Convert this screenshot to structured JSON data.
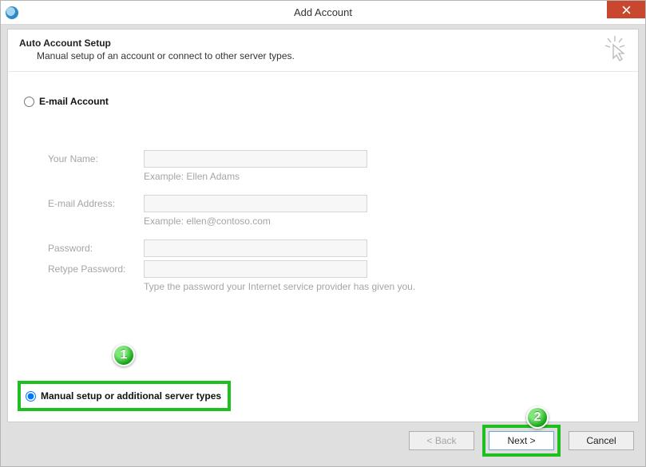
{
  "window": {
    "title": "Add Account"
  },
  "header": {
    "title": "Auto Account Setup",
    "subtitle": "Manual setup of an account or connect to other server types."
  },
  "radios": {
    "email_label": "E-mail Account",
    "manual_label": "Manual setup or additional server types"
  },
  "fields": {
    "name_label": "Your Name:",
    "name_hint": "Example: Ellen Adams",
    "email_label": "E-mail Address:",
    "email_hint": "Example: ellen@contoso.com",
    "password_label": "Password:",
    "retype_label": "Retype Password:",
    "password_hint": "Type the password your Internet service provider has given you."
  },
  "buttons": {
    "back": "< Back",
    "next": "Next >",
    "cancel": "Cancel"
  },
  "callouts": {
    "one": "1",
    "two": "2"
  }
}
